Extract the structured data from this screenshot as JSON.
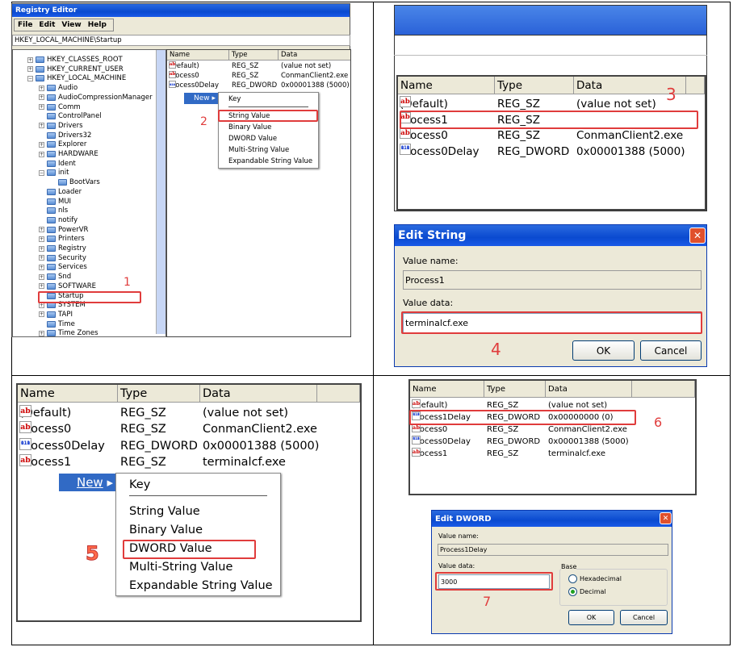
{
  "panel1": {
    "title": "Registry Editor",
    "menu": [
      "File",
      "Edit",
      "View",
      "Help"
    ],
    "address": "HKEY_LOCAL_MACHINE\\Startup",
    "tree": [
      {
        "label": "HKEY_CLASSES_ROOT",
        "level": 0,
        "exp": "+"
      },
      {
        "label": "HKEY_CURRENT_USER",
        "level": 0,
        "exp": "+"
      },
      {
        "label": "HKEY_LOCAL_MACHINE",
        "level": 0,
        "exp": "-"
      },
      {
        "label": "Audio",
        "level": 1,
        "exp": "+"
      },
      {
        "label": "AudioCompressionManager",
        "level": 1,
        "exp": "+"
      },
      {
        "label": "Comm",
        "level": 1,
        "exp": "+"
      },
      {
        "label": "ControlPanel",
        "level": 1,
        "exp": ""
      },
      {
        "label": "Drivers",
        "level": 1,
        "exp": "+"
      },
      {
        "label": "Drivers32",
        "level": 1,
        "exp": ""
      },
      {
        "label": "Explorer",
        "level": 1,
        "exp": "+"
      },
      {
        "label": "HARDWARE",
        "level": 1,
        "exp": "+"
      },
      {
        "label": "Ident",
        "level": 1,
        "exp": ""
      },
      {
        "label": "init",
        "level": 1,
        "exp": "-"
      },
      {
        "label": "BootVars",
        "level": 2,
        "exp": ""
      },
      {
        "label": "Loader",
        "level": 1,
        "exp": ""
      },
      {
        "label": "MUI",
        "level": 1,
        "exp": ""
      },
      {
        "label": "nls",
        "level": 1,
        "exp": ""
      },
      {
        "label": "notify",
        "level": 1,
        "exp": ""
      },
      {
        "label": "PowerVR",
        "level": 1,
        "exp": "+"
      },
      {
        "label": "Printers",
        "level": 1,
        "exp": "+"
      },
      {
        "label": "Registry",
        "level": 1,
        "exp": "+"
      },
      {
        "label": "Security",
        "level": 1,
        "exp": "+"
      },
      {
        "label": "Services",
        "level": 1,
        "exp": "+"
      },
      {
        "label": "Snd",
        "level": 1,
        "exp": "+"
      },
      {
        "label": "SOFTWARE",
        "level": 1,
        "exp": "+"
      },
      {
        "label": "Startup",
        "level": 1,
        "exp": "",
        "selected": true
      },
      {
        "label": "SYSTEM",
        "level": 1,
        "exp": "+"
      },
      {
        "label": "TAPI",
        "level": 1,
        "exp": "+"
      },
      {
        "label": "Time",
        "level": 1,
        "exp": ""
      },
      {
        "label": "Time Zones",
        "level": 1,
        "exp": "+"
      }
    ],
    "list": {
      "headers": [
        "Name",
        "Type",
        "Data"
      ],
      "rows": [
        {
          "icon": "string-value-icon",
          "name": "(Default)",
          "type": "REG_SZ",
          "data": "(value not set)"
        },
        {
          "icon": "string-value-icon",
          "name": "Process0",
          "type": "REG_SZ",
          "data": "ConmanClient2.exe"
        },
        {
          "icon": "dword-value-icon",
          "name": "Process0Delay",
          "type": "REG_DWORD",
          "data": "0x00001388 (5000)"
        }
      ]
    },
    "new_label": "New",
    "submenu": [
      "Key",
      "String Value",
      "Binary Value",
      "DWORD Value",
      "Multi-String Value",
      "Expandable String Value"
    ],
    "annotations": [
      "1",
      "2"
    ]
  },
  "panel2": {
    "list": {
      "headers": [
        "Name",
        "Type",
        "Data"
      ],
      "rows": [
        {
          "icon": "string-value-icon",
          "name": "(Default)",
          "type": "REG_SZ",
          "data": "(value not set)"
        },
        {
          "icon": "string-value-icon",
          "name": "Process1",
          "type": "REG_SZ",
          "data": ""
        },
        {
          "icon": "string-value-icon",
          "name": "Process0",
          "type": "REG_SZ",
          "data": "ConmanClient2.exe"
        },
        {
          "icon": "dword-value-icon",
          "name": "Process0Delay",
          "type": "REG_DWORD",
          "data": "0x00001388 (5000)"
        }
      ]
    },
    "annotation": "3",
    "dialog": {
      "title": "Edit String",
      "value_name_label": "Value name:",
      "value_name": "Process1",
      "value_data_label": "Value data:",
      "value_data": "terminalcf.exe",
      "ok": "OK",
      "cancel": "Cancel",
      "annotation": "4"
    }
  },
  "panel3": {
    "list": {
      "headers": [
        "Name",
        "Type",
        "Data"
      ],
      "rows": [
        {
          "icon": "string-value-icon",
          "name": "(Default)",
          "type": "REG_SZ",
          "data": "(value not set)"
        },
        {
          "icon": "string-value-icon",
          "name": "Process0",
          "type": "REG_SZ",
          "data": "ConmanClient2.exe"
        },
        {
          "icon": "dword-value-icon",
          "name": "Process0Delay",
          "type": "REG_DWORD",
          "data": "0x00001388 (5000)"
        },
        {
          "icon": "string-value-icon",
          "name": "Process1",
          "type": "REG_SZ",
          "data": "terminalcf.exe"
        }
      ]
    },
    "new_label": "New",
    "submenu": [
      "Key",
      "String Value",
      "Binary Value",
      "DWORD Value",
      "Multi-String Value",
      "Expandable String Value"
    ],
    "annotation": "5"
  },
  "panel4": {
    "list": {
      "headers": [
        "Name",
        "Type",
        "Data"
      ],
      "rows": [
        {
          "icon": "string-value-icon",
          "name": "(Default)",
          "type": "REG_SZ",
          "data": "(value not set)"
        },
        {
          "icon": "dword-value-icon",
          "name": "Process1Delay",
          "type": "REG_DWORD",
          "data": "0x00000000 (0)"
        },
        {
          "icon": "string-value-icon",
          "name": "Process0",
          "type": "REG_SZ",
          "data": "ConmanClient2.exe"
        },
        {
          "icon": "dword-value-icon",
          "name": "Process0Delay",
          "type": "REG_DWORD",
          "data": "0x00001388 (5000)"
        },
        {
          "icon": "string-value-icon",
          "name": "Process1",
          "type": "REG_SZ",
          "data": "terminalcf.exe"
        }
      ]
    },
    "annotation": "6",
    "dialog": {
      "title": "Edit DWORD",
      "value_name_label": "Value name:",
      "value_name": "Process1Delay",
      "value_data_label": "Value data:",
      "value_data": "3000",
      "base_label": "Base",
      "base_options": [
        "Hexadecimal",
        "Decimal"
      ],
      "base_selected": "Decimal",
      "ok": "OK",
      "cancel": "Cancel",
      "annotation": "7"
    }
  },
  "colors": {
    "annotation": "#e03c3c",
    "titlebar": "#0a4ad0",
    "menu_highlight": "#316ac5"
  }
}
